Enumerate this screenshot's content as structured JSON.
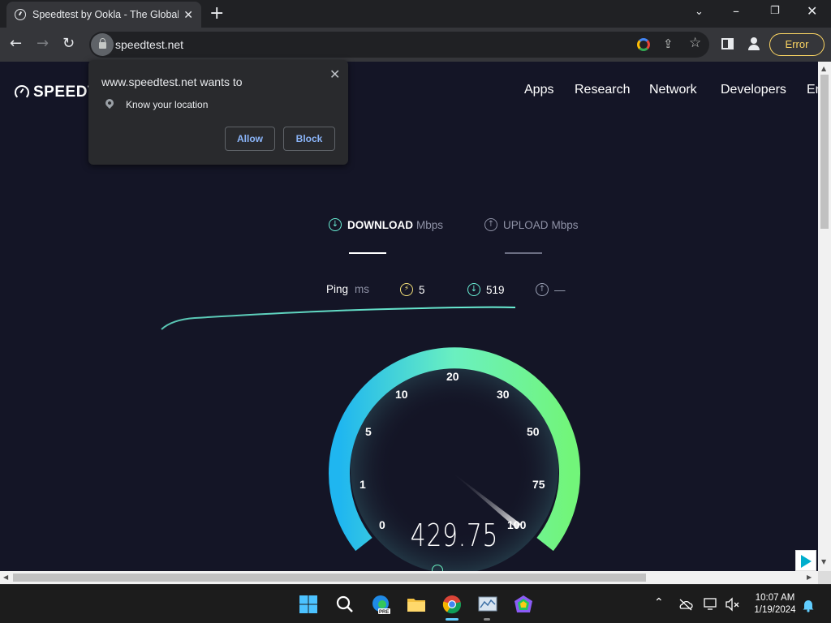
{
  "browser": {
    "tab_title": "Speedtest by Ookla - The Global",
    "url": "speedtest.net",
    "error_label": "Error"
  },
  "site": {
    "logo_text": "SPEEDT",
    "nav": [
      "Apps",
      "Research",
      "Network",
      "Developers",
      "En"
    ]
  },
  "permission_popup": {
    "title": "www.speedtest.net wants to",
    "request": "Know your location",
    "allow_label": "Allow",
    "block_label": "Block"
  },
  "test_tabs": {
    "download_label": "DOWNLOAD",
    "download_unit": "Mbps",
    "upload_label": "UPLOAD",
    "upload_unit": "Mbps"
  },
  "stats": {
    "ping_label": "Ping",
    "ping_unit": "ms",
    "ping_value": "5",
    "download_value": "519",
    "upload_value": "—"
  },
  "gauge": {
    "labels": [
      "0",
      "1",
      "5",
      "10",
      "20",
      "30",
      "50",
      "75",
      "100"
    ],
    "current_speed": "429.75"
  },
  "taskbar": {
    "time": "10:07 AM",
    "date": "1/19/2024"
  },
  "colors": {
    "page_bg": "#141526",
    "gauge_start": "#1fb6f0",
    "gauge_mid": "#6af0c0",
    "gauge_end": "#72f57a",
    "ping_accent": "#f6e27a",
    "download_accent": "#6af0d6",
    "upload_accent": "#9aa0b4"
  }
}
